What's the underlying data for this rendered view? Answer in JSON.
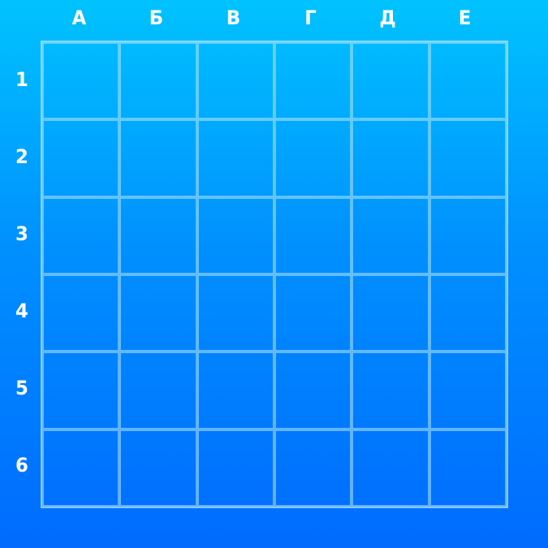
{
  "board": {
    "columns": [
      "А",
      "Б",
      "В",
      "Г",
      "Д",
      "Е"
    ],
    "rows": [
      "1",
      "2",
      "3",
      "4",
      "5",
      "6"
    ]
  },
  "colors": {
    "background_top": "#00c3fe",
    "background_bottom": "#006bfe",
    "grid_line": "#b4e6ff",
    "label": "#ffffff"
  }
}
